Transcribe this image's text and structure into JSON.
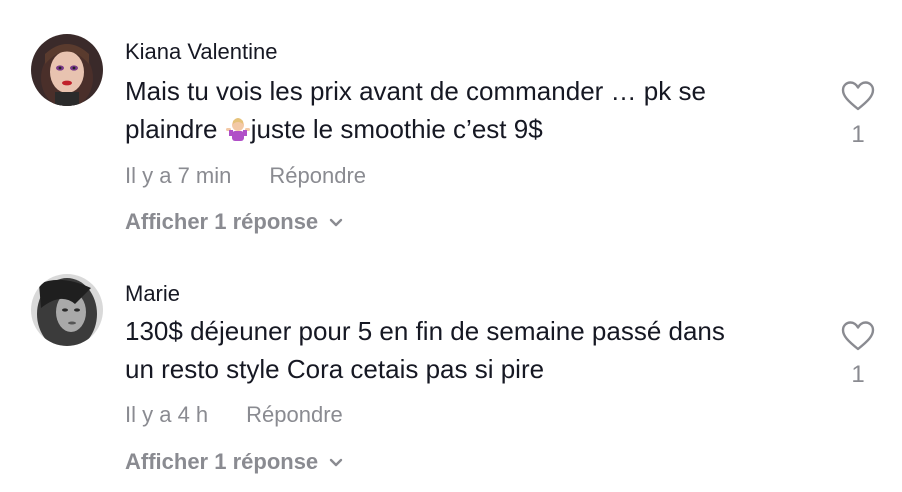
{
  "comments": [
    {
      "author": "Kiana Valentine",
      "text_before_emoji": "Mais tu vois les prix avant de commander … pk se\nplaindre ",
      "emoji": "woman-shrugging-emoji",
      "text_after_emoji": "juste le smoothie c’est 9$",
      "time": "Il y a 7 min",
      "reply_label": "Répondre",
      "view_replies": "Afficher 1 réponse",
      "likes": "1"
    },
    {
      "author": "Marie",
      "text": "130$ déjeuner pour 5 en fin de semaine passé dans\nun resto style Cora cetais pas si pire",
      "time": "Il y a 4 h",
      "reply_label": "Répondre",
      "view_replies": "Afficher 1 réponse",
      "likes": "1"
    }
  ],
  "icons": {
    "like": "heart-outline-icon",
    "expand": "chevron-down-icon"
  },
  "colors": {
    "text_primary": "#161823",
    "text_secondary": "#8a8b91"
  }
}
